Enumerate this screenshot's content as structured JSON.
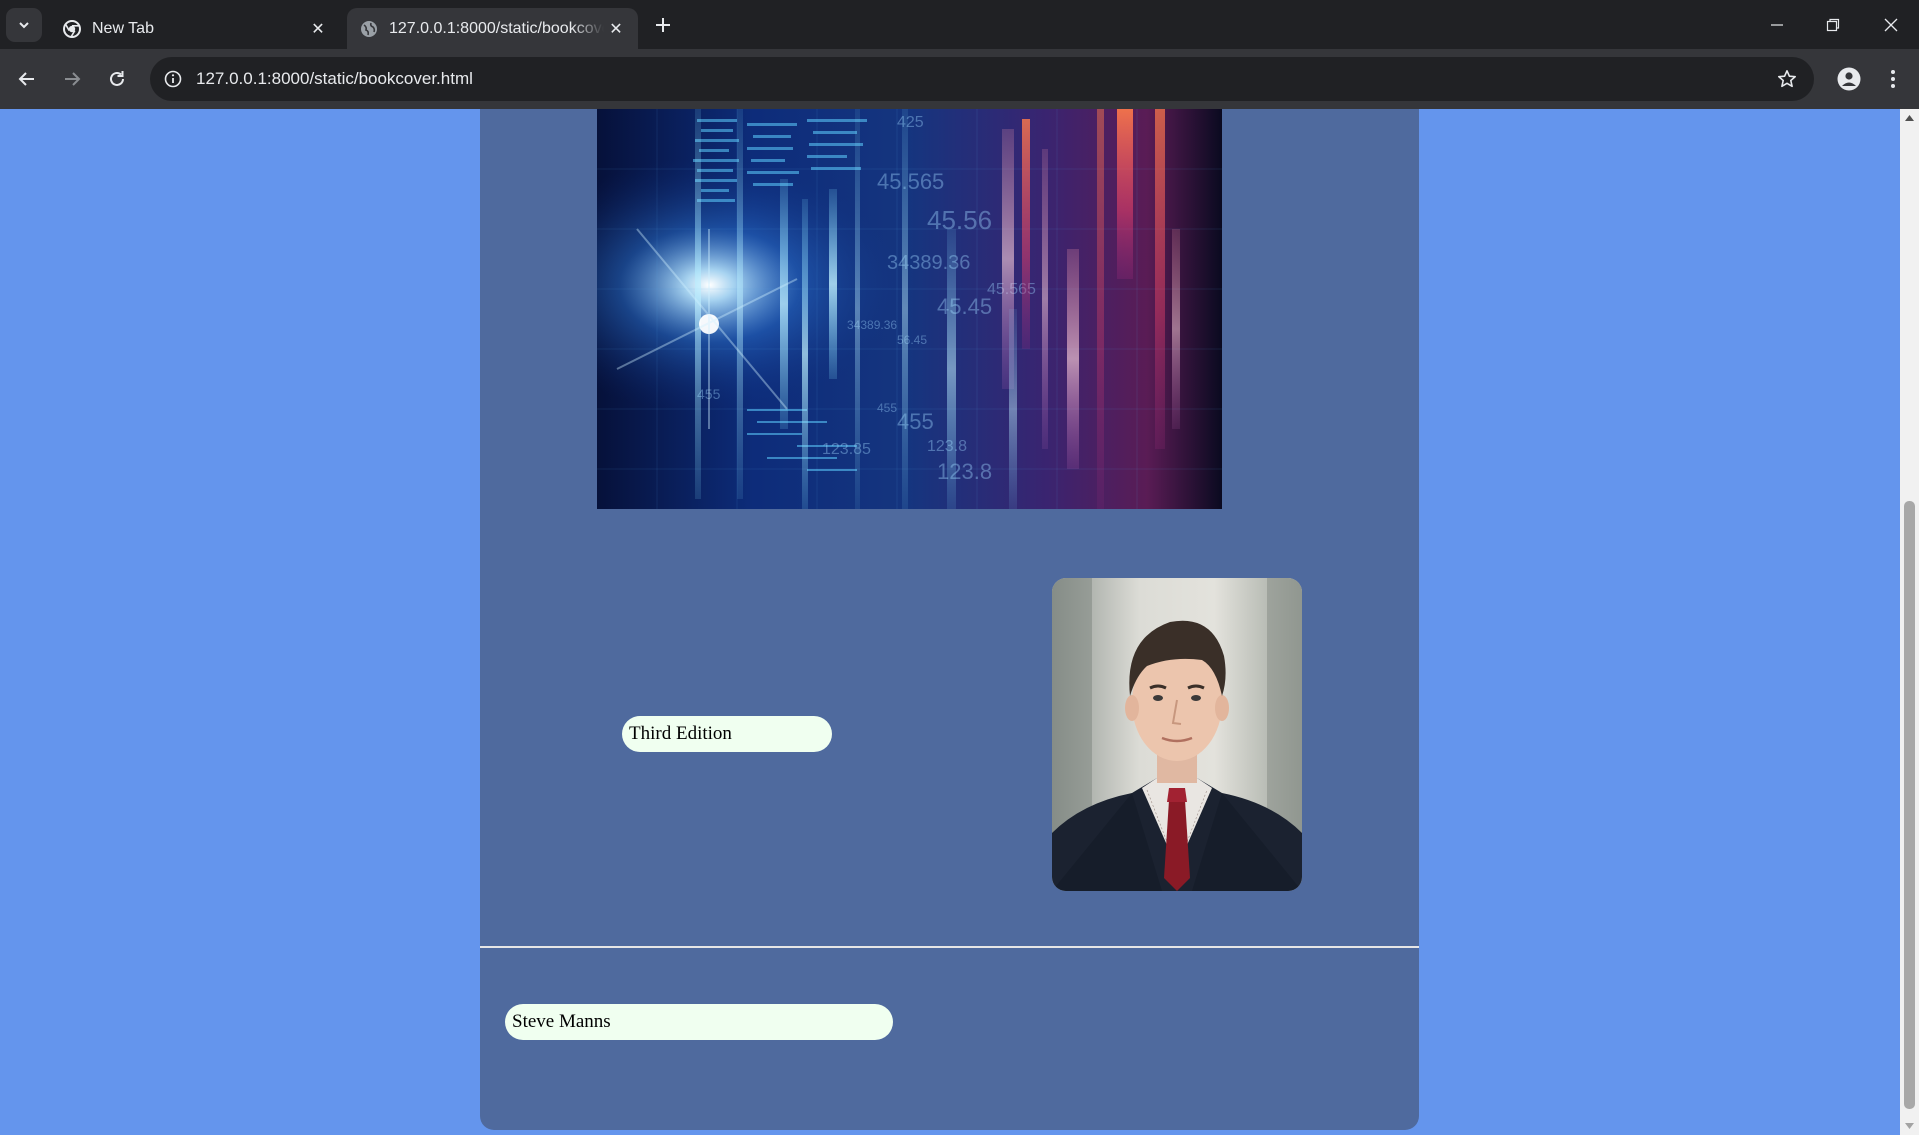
{
  "browser": {
    "tabs": [
      {
        "title": "New Tab",
        "favicon": "chrome-icon",
        "active": false
      },
      {
        "title": "127.0.0.1:8000/static/bookcover.html",
        "favicon": "globe-icon",
        "active": true
      }
    ],
    "url": "127.0.0.1:8000/static/bookcover.html"
  },
  "page": {
    "background_color": "#6495ED",
    "cover_color": "#4F6A9E",
    "pill_color": "#F0FFF0",
    "edition": "Third Edition",
    "author": "Steve Manns",
    "cover_image": "abstract-data-technology-image",
    "author_image": "author-portrait-photo"
  }
}
